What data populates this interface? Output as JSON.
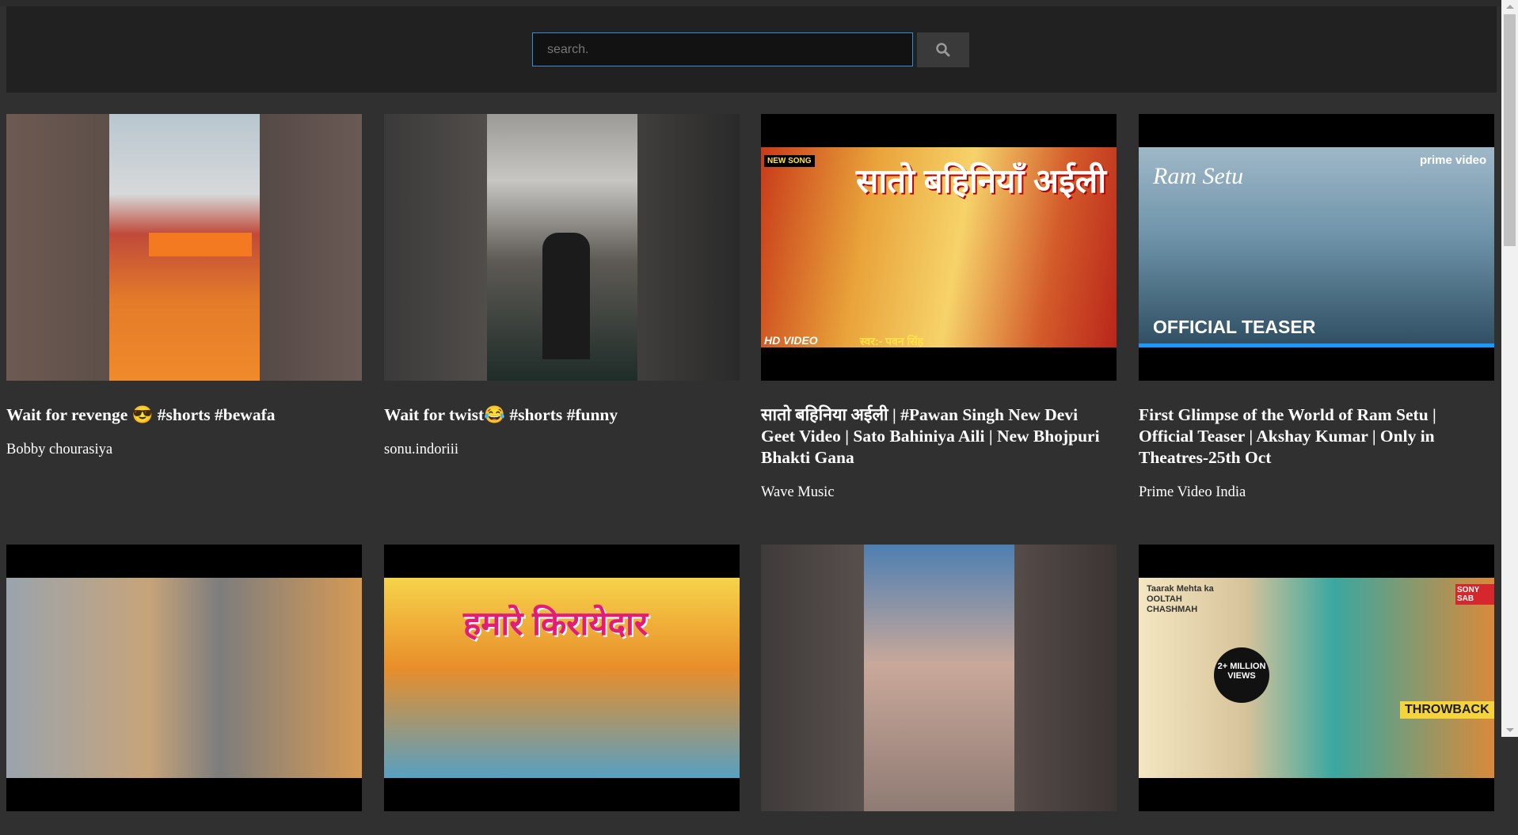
{
  "search": {
    "placeholder": "search."
  },
  "icons": {
    "search_button": "search-icon"
  },
  "videos": [
    {
      "title": "Wait for revenge 😎 #shorts #bewafa",
      "channel": "Bobby chourasiya"
    },
    {
      "title": "Wait for twist😂 #shorts #funny",
      "channel": "sonu.indoriii"
    },
    {
      "title": "सातो बहिनिया अईली | #Pawan Singh New Devi Geet Video | Sato Bahiniya Aili | New Bhojpuri Bhakti Gana",
      "channel": "Wave Music",
      "thumb_text": {
        "badge": "NEW SONG",
        "title": "सातो बहिनियाँ अईली",
        "hd": "HD VIDEO",
        "singer": "स्वर:- पवन सिंह"
      }
    },
    {
      "title": "First Glimpse of the World of Ram Setu | Official Teaser | Akshay Kumar | Only in Theatres-25th Oct",
      "channel": "Prime Video India",
      "thumb_text": {
        "logo": "Ram Setu",
        "brand": "prime video",
        "caption": "OFFICIAL TEASER"
      }
    },
    {
      "title": "",
      "channel": ""
    },
    {
      "title": "",
      "channel": "",
      "thumb_text": {
        "title": "हमारे किरायेदार"
      }
    },
    {
      "title": "",
      "channel": ""
    },
    {
      "title": "",
      "channel": "",
      "thumb_text": {
        "show": "Taarak Mehta ka OOLTAH CHASHMAH",
        "views": "2+ MILLION VIEWS",
        "tag": "THROWBACK",
        "brand": "SONY SAB"
      }
    }
  ]
}
